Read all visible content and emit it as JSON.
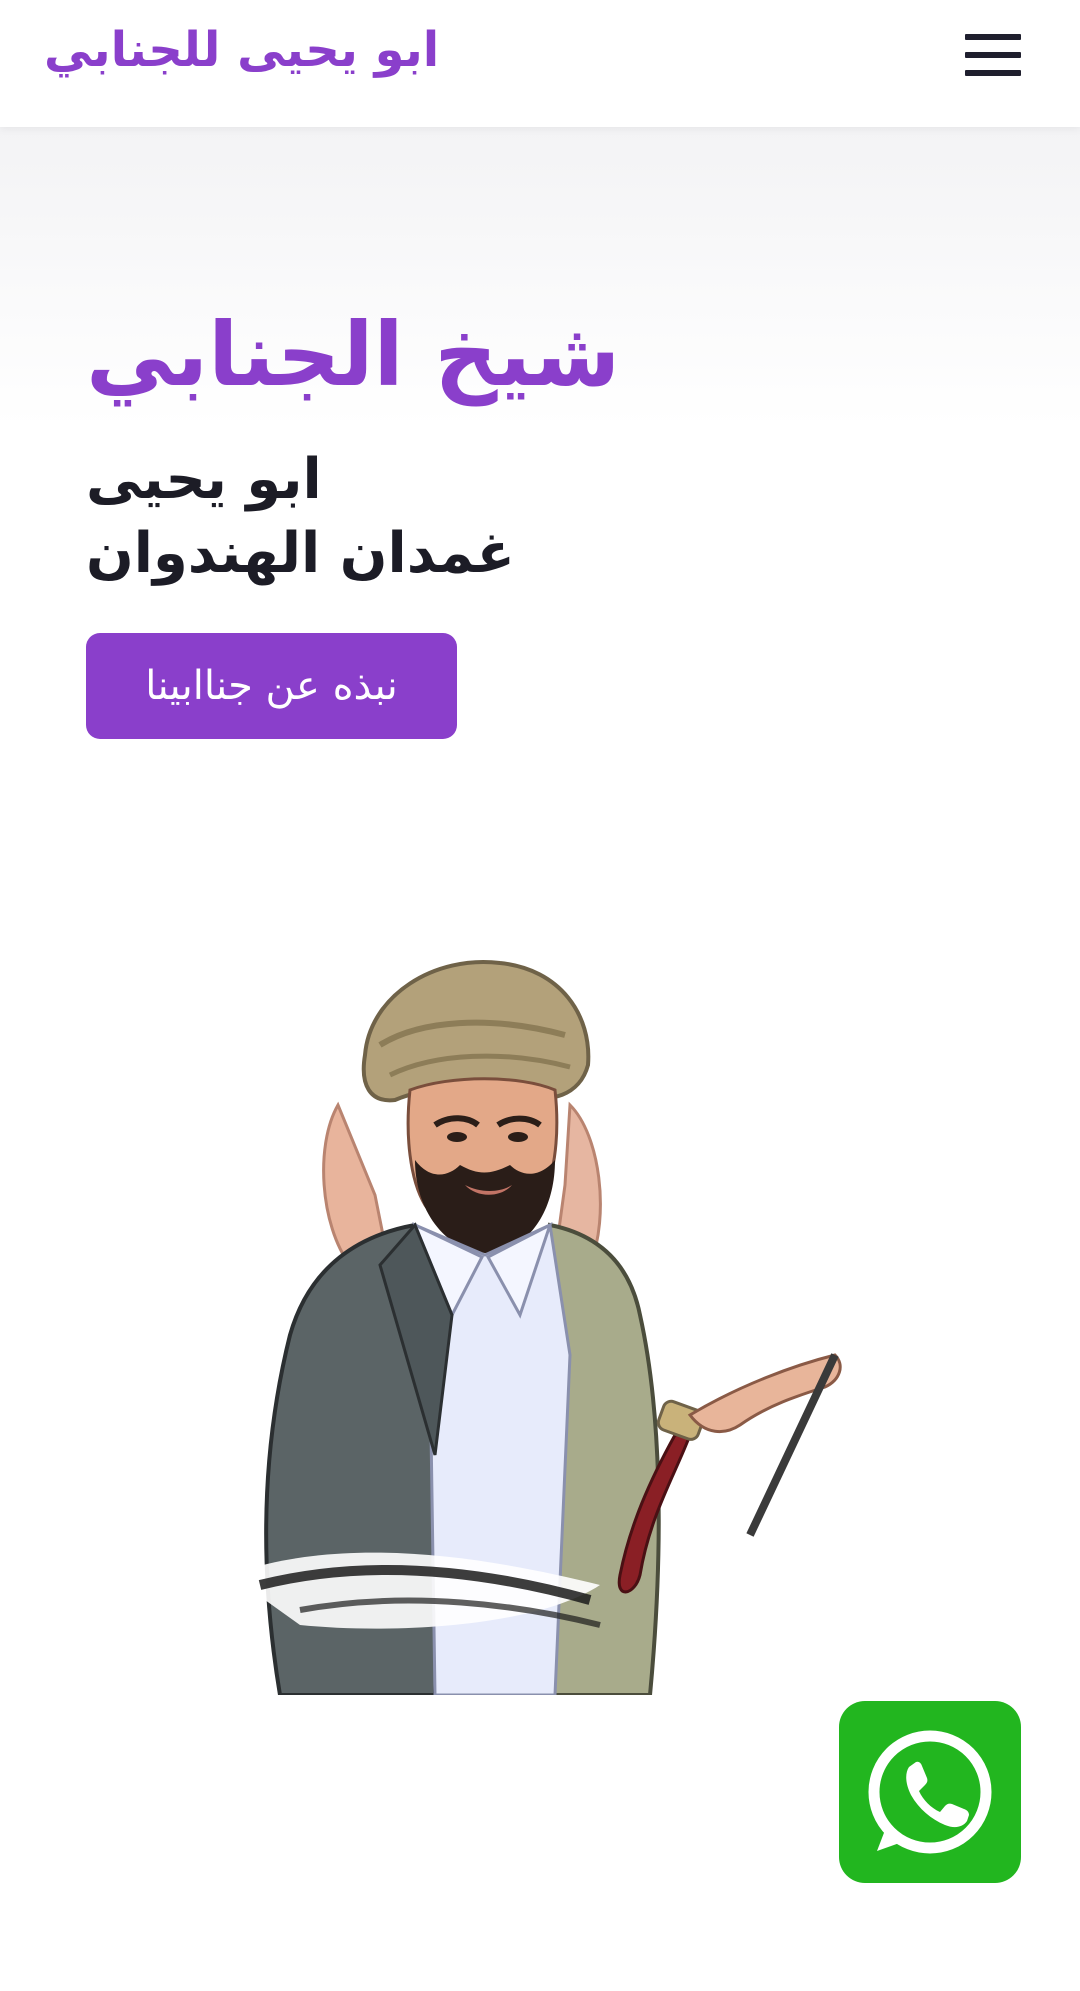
{
  "header": {
    "brand": "ابو يحيى للجنابي",
    "menu_icon": "hamburger-menu-icon"
  },
  "hero": {
    "title": "شيخ الجنابي",
    "subtitle_line1": "ابو يحيى",
    "subtitle_line2": "غمدان الهندوان",
    "cta_label": "نبذه عن جناابينا"
  },
  "floating": {
    "whatsapp_icon": "whatsapp-icon"
  },
  "colors": {
    "accent": "#8a3fcb",
    "text_dark": "#1c1c26",
    "whatsapp_green": "#22b61f",
    "whatsapp_shadow": "#12900f"
  }
}
